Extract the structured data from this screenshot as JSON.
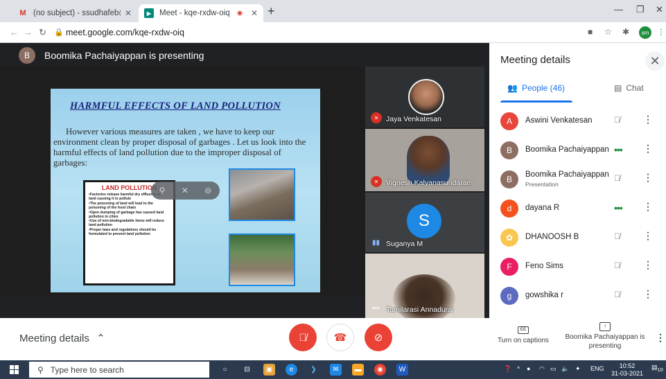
{
  "browser": {
    "tabs": [
      {
        "title": "(no subject) - ssudhafeb@gmail.",
        "icon": "gmail-icon"
      },
      {
        "title": "Meet - kqe-rxdw-oiq",
        "icon": "meet-icon",
        "recording": true
      }
    ],
    "url": "meet.google.com/kqe-rxdw-oiq",
    "profile_initials": "sm"
  },
  "presenter": {
    "initial": "B",
    "text": "Boomika Pachaiyappan is presenting"
  },
  "slide": {
    "title": "HARMFUL EFFECTS OF LAND POLLUTION",
    "body": "However various measures are taken , we have to keep our environment clean by proper disposal of garbages . Let us look into the harmful effects of land pollution due to the improper disposal of garbages:",
    "box_title": "LAND POLLUTION",
    "bullets": [
      "Factories release harmful dry effluents on land causing it to pollute",
      "The poisoning of land will lead to the poisoning of the food chain",
      "Open dumping of garbage has caused land pollution in cities",
      "Use of non-biodegradable items will reduce land pollution",
      "Proper laws and regulations should be formulated to prevent land pollution"
    ]
  },
  "tiles": [
    {
      "name": "Jaya Venkatesan",
      "muted": true
    },
    {
      "name": "Vignesh Kalyanasundaram",
      "muted": true
    },
    {
      "name": "Suganya M",
      "initial": "S",
      "speaking": true
    },
    {
      "name": "Tamilarasi Annadurai",
      "speaking": true
    }
  ],
  "panel": {
    "title": "Meeting details",
    "people_tab": "People (46)",
    "chat_tab": "Chat",
    "people": [
      {
        "initial": "A",
        "name": "Aswini Venkatesan",
        "color": "#e8453c",
        "status": "muted"
      },
      {
        "initial": "B",
        "name": "Boomika Pachaiyappan",
        "color": "#8d6e63",
        "status": "speaking"
      },
      {
        "initial": "B",
        "name": "Boomika Pachaiyappan",
        "sub": "Presentation",
        "color": "#8d6e63",
        "status": "muted"
      },
      {
        "initial": "d",
        "name": "dayana R",
        "color": "#f4511e",
        "status": "speaking"
      },
      {
        "initial": "",
        "name": "DHANOOSH B",
        "color": "#f9c74f",
        "status": "muted"
      },
      {
        "initial": "F",
        "name": "Feno Sims",
        "color": "#e91e63",
        "status": "muted"
      },
      {
        "initial": "g",
        "name": "gowshika r",
        "color": "#5c6bc0",
        "status": "muted"
      }
    ]
  },
  "bottom": {
    "details_label": "Meeting details",
    "captions_label": "Turn on captions",
    "presenting_label": "Boomika Pachaiyappan is presenting"
  },
  "taskbar": {
    "search_placeholder": "Type here to search",
    "time": "10:52",
    "date": "31-03-2021",
    "lang": "ENG",
    "notif_count": "10"
  }
}
